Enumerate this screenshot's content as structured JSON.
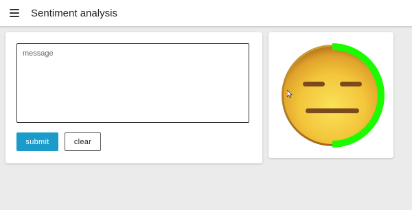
{
  "appbar": {
    "title": "Sentiment analysis",
    "menu_icon": "hamburger-menu-icon"
  },
  "form": {
    "message_placeholder": "message",
    "message_value": "",
    "submit_label": "submit",
    "clear_label": "clear"
  },
  "sentiment": {
    "face_icon": "neutral-face-emoji-icon",
    "score_fraction": 0.5,
    "ring_color": "#1dfb00"
  },
  "colors": {
    "accent": "#1b9bc9",
    "background": "#ebebeb"
  }
}
